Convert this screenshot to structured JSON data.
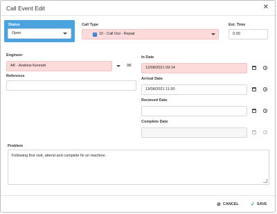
{
  "dialog": {
    "title": "Call Event Edit",
    "close_icon": "close-icon"
  },
  "status": {
    "label": "Status",
    "value": "Open"
  },
  "call_type": {
    "label": "Call Type",
    "value": "10 - Call Out - Repair"
  },
  "est_time": {
    "label": "Est. Time",
    "value": "0.00"
  },
  "engineer": {
    "label": "Engineer",
    "value": "AK - Andrew Kennett"
  },
  "reference": {
    "label": "Reference",
    "value": ""
  },
  "in_date": {
    "label": "In Date",
    "value": "12/08/2021 09:14"
  },
  "arrival_date": {
    "label": "Arrival Date",
    "value": "13/08/2021 11:30"
  },
  "received_date": {
    "label": "Recieved Date",
    "value": ""
  },
  "complete_date": {
    "label": "Complete Date",
    "value": ""
  },
  "problem": {
    "label": "Problem",
    "value": "Following first visit, attend and complete fix on machine."
  },
  "footer": {
    "cancel_label": "CANCEL",
    "save_label": "SAVE"
  },
  "colors": {
    "status_accent": "#4aa3df",
    "required_field": "#fddbdb",
    "save": "#2e9e3f"
  }
}
